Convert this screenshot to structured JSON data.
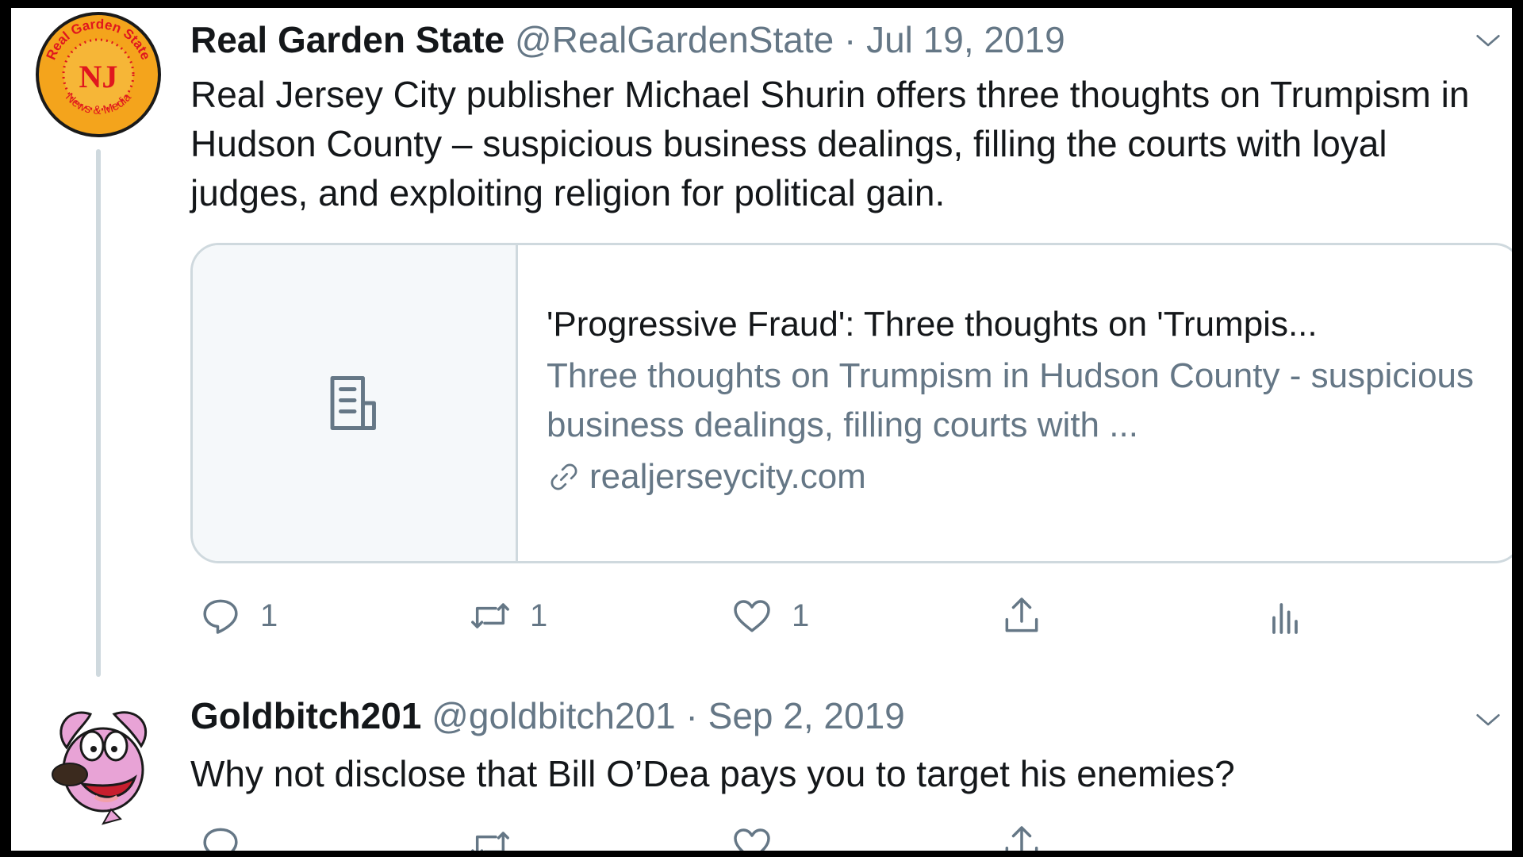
{
  "tweets": [
    {
      "name": "Real Garden State",
      "handle": "@RealGardenState",
      "separator": "·",
      "date": "Jul 19, 2019",
      "text": "Real Jersey City publisher Michael Shurin offers three thoughts on Trumpism in Hudson County – suspicious business dealings, filling the courts with loyal judges, and exploiting religion for political gain.",
      "avatar": {
        "icon": "garden-state-logo",
        "initials": "NJ",
        "arc_top": "Real Garden State",
        "arc_bottom": "News & Media",
        "colors": {
          "outer": "#f4a41c",
          "inner": "#e0161e",
          "ring": "#1a1a1a"
        }
      },
      "card": {
        "icon": "document-icon",
        "title": "'Progressive Fraud': Three thoughts on 'Trumpis...",
        "description": "Three thoughts on Trumpism in Hudson County - suspicious business dealings, filling courts with ...",
        "domain_icon": "link-icon",
        "domain": "realjerseycity.com"
      },
      "actions": {
        "reply_count": "1",
        "retweet_count": "1",
        "like_count": "1"
      }
    },
    {
      "name": "Goldbitch201",
      "handle": "@goldbitch201",
      "separator": "·",
      "date": "Sep 2, 2019",
      "text": "Why not disclose that Bill O’Dea pays you to target his enemies?",
      "avatar": {
        "icon": "cartoon-dog-avatar",
        "colors": {
          "skin": "#e8a3d6",
          "bg": "#ffffff"
        }
      }
    }
  ],
  "theme": {
    "text": "#14171a",
    "muted": "#657786",
    "border": "#cfd9de"
  }
}
